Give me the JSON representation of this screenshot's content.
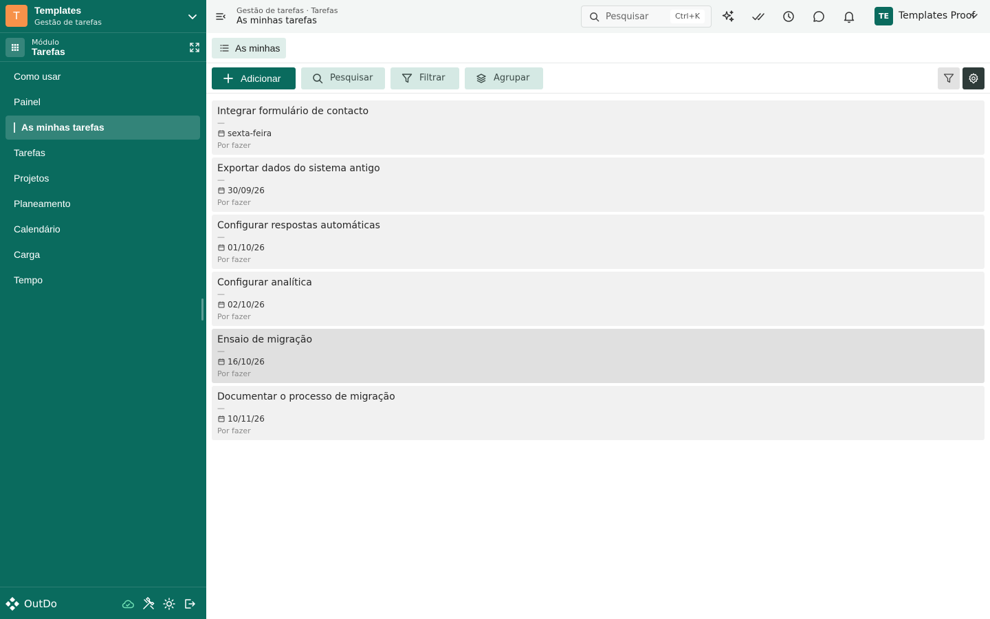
{
  "colors": {
    "brand": "#0a6b5e",
    "workspace_logo": "#f7924a",
    "accent_soft": "#d5e9e4"
  },
  "workspace": {
    "initial": "T",
    "title": "Templates",
    "subtitle": "Gestão de tarefas"
  },
  "module": {
    "label": "Módulo",
    "name": "Tarefas"
  },
  "sidebar": {
    "items": [
      {
        "label": "Como usar",
        "active": false
      },
      {
        "label": "Painel",
        "active": false
      },
      {
        "label": "As minhas tarefas",
        "active": true
      },
      {
        "label": "Tarefas",
        "active": false
      },
      {
        "label": "Projetos",
        "active": false
      },
      {
        "label": "Planeamento",
        "active": false
      },
      {
        "label": "Calendário",
        "active": false
      },
      {
        "label": "Carga",
        "active": false
      },
      {
        "label": "Tempo",
        "active": false
      }
    ],
    "footer": {
      "brand": "OutDo",
      "icons": [
        "cloud-check-icon",
        "tools-icon",
        "sun-icon",
        "logout-icon"
      ]
    }
  },
  "header": {
    "breadcrumb": "Gestão de tarefas · Tarefas",
    "title": "As minhas tarefas",
    "search": {
      "placeholder": "Pesquisar",
      "shortcut": "Ctrl+K"
    },
    "icons": [
      "sparkles-icon",
      "double-check-icon",
      "clock-icon",
      "chat-icon",
      "bell-icon"
    ],
    "user": {
      "initials": "TE",
      "name": "Templates Proof"
    }
  },
  "view": {
    "tab_label": "As minhas"
  },
  "toolbar": {
    "add_label": "Adicionar",
    "search_label": "Pesquisar",
    "filter_label": "Filtrar",
    "group_label": "Agrupar"
  },
  "tasks": [
    {
      "title": "Integrar formulário de contacto",
      "separator": "—",
      "date": "sexta-feira",
      "status": "Por fazer"
    },
    {
      "title": "Exportar dados do sistema antigo",
      "separator": "—",
      "date": "30/09/26",
      "status": "Por fazer"
    },
    {
      "title": "Configurar respostas automáticas",
      "separator": "—",
      "date": "01/10/26",
      "status": "Por fazer"
    },
    {
      "title": "Configurar analítica",
      "separator": "—",
      "date": "02/10/26",
      "status": "Por fazer"
    },
    {
      "title": "Ensaio de migração",
      "separator": "—",
      "date": "16/10/26",
      "status": "Por fazer",
      "hovered": true
    },
    {
      "title": "Documentar o processo de migração",
      "separator": "—",
      "date": "10/11/26",
      "status": "Por fazer"
    }
  ]
}
